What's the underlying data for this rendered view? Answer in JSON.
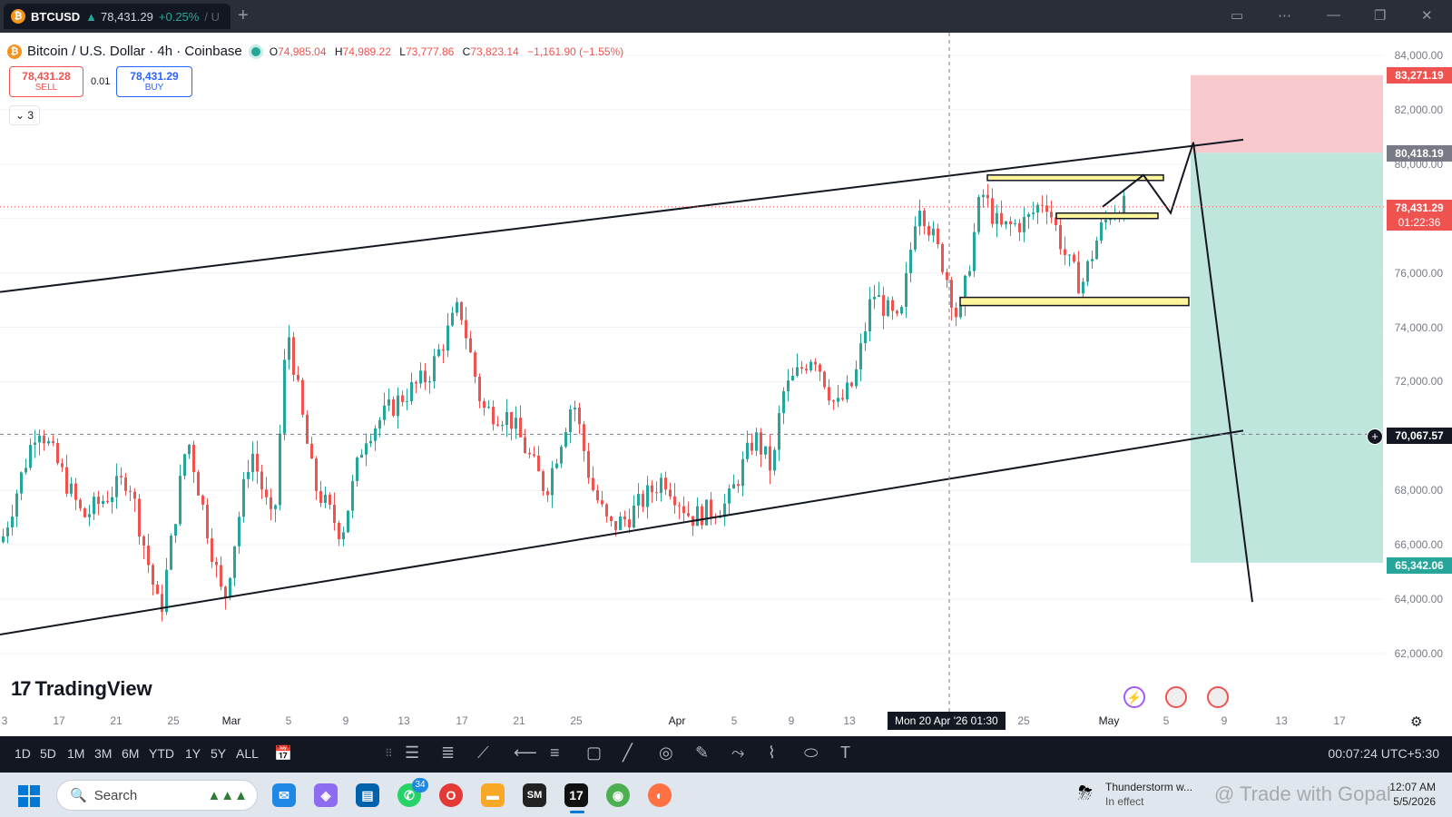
{
  "tab": {
    "symbol": "BTCUSD",
    "direction": "▲",
    "price": "78,431.29",
    "change": "+0.25%",
    "sep": "/ U"
  },
  "legend": {
    "title": "Bitcoin / U.S. Dollar · 4h · Coinbase",
    "o_key": "O",
    "o": "74,985.04",
    "h_key": "H",
    "h": "74,989.22",
    "l_key": "L",
    "l": "73,777.86",
    "c_key": "C",
    "c": "73,823.14",
    "chg": "−1,161.90 (−1.55%)"
  },
  "trade": {
    "sell_price": "78,431.28",
    "sell_label": "SELL",
    "spread": "0.01",
    "buy_price": "78,431.29",
    "buy_label": "BUY",
    "collapse": "3"
  },
  "price_scale": {
    "ticks": [
      "84,000.00",
      "82,000.00",
      "80,000.00",
      "78,000.00",
      "76,000.00",
      "74,000.00",
      "72,000.00",
      "70,000.00",
      "68,000.00",
      "66,000.00",
      "64,000.00",
      "62,000.00"
    ],
    "target_label": "83,271.19",
    "entry_label": "80,418.19",
    "current_price": "78,431.29",
    "countdown": "01:22:36",
    "crosshair_price": "70,067.57",
    "stop_label": "65,342.06"
  },
  "time_axis": {
    "ticks": [
      "3",
      "17",
      "21",
      "25",
      "Mar",
      "5",
      "9",
      "13",
      "17",
      "21",
      "25",
      "Apr",
      "5",
      "9",
      "13",
      "25",
      "May",
      "5",
      "9",
      "13",
      "17"
    ],
    "crosshair_label": "Mon 20 Apr '26   01:30"
  },
  "brand": "TradingView",
  "timeframes": [
    "1D",
    "5D",
    "1M",
    "3M",
    "6M",
    "YTD",
    "1Y",
    "5Y",
    "ALL"
  ],
  "clock": "00:07:24 UTC+5:30",
  "taskbar": {
    "search": "Search",
    "whatsapp_badge": "34",
    "weather_title": "Thunderstorm w...",
    "weather_sub": "In effect",
    "time": "12:07 AM",
    "date": "5/5/2026"
  },
  "watermark": "@ Trade with Gopal",
  "colors": {
    "up": "#26a69a",
    "down": "#ef5350",
    "target_zone": "#f8c9cc",
    "stop_zone": "#bfe6dc",
    "zone_fill": "#fff59d"
  },
  "chart_data": {
    "type": "candlestick",
    "instrument": "BTCUSD",
    "interval": "4h",
    "ylim": [
      61000,
      85500
    ],
    "annotations": {
      "channel_upper": [
        [
          0,
          75300
        ],
        [
          1370,
          80900
        ]
      ],
      "channel_lower": [
        [
          0,
          62700
        ],
        [
          1370,
          70200
        ]
      ],
      "supply_zone_top": [
        79400,
        79600
      ],
      "supply_zone_mid": [
        78000,
        78200
      ],
      "demand_zone": [
        74800,
        75100
      ],
      "short_position": {
        "entry": 80418.19,
        "target": 65342.06,
        "stop": 83271.19
      },
      "projected_path": [
        [
          1215,
          78430
        ],
        [
          1260,
          79600
        ],
        [
          1290,
          78200
        ],
        [
          1315,
          80800
        ],
        [
          1380,
          63900
        ]
      ]
    },
    "price_path": [
      [
        0,
        66100
      ],
      [
        40,
        70500
      ],
      [
        90,
        67000
      ],
      [
        140,
        68500
      ],
      [
        175,
        63400
      ],
      [
        205,
        70000
      ],
      [
        245,
        63800
      ],
      [
        275,
        69600
      ],
      [
        300,
        66500
      ],
      [
        315,
        74100
      ],
      [
        330,
        71000
      ],
      [
        345,
        68200
      ],
      [
        375,
        66400
      ],
      [
        400,
        70000
      ],
      [
        440,
        71400
      ],
      [
        470,
        72200
      ],
      [
        505,
        74800
      ],
      [
        530,
        71000
      ],
      [
        560,
        70700
      ],
      [
        600,
        68000
      ],
      [
        630,
        71400
      ],
      [
        650,
        68200
      ],
      [
        670,
        66600
      ],
      [
        690,
        67000
      ],
      [
        730,
        68500
      ],
      [
        760,
        67000
      ],
      [
        800,
        67500
      ],
      [
        830,
        70000
      ],
      [
        850,
        68700
      ],
      [
        860,
        71500
      ],
      [
        895,
        73100
      ],
      [
        920,
        71000
      ],
      [
        940,
        72000
      ],
      [
        960,
        75300
      ],
      [
        990,
        74000
      ],
      [
        1010,
        78800
      ],
      [
        1040,
        76100
      ],
      [
        1055,
        74100
      ],
      [
        1080,
        79000
      ],
      [
        1100,
        77600
      ],
      [
        1130,
        77900
      ],
      [
        1150,
        78800
      ],
      [
        1175,
        76400
      ],
      [
        1190,
        75500
      ],
      [
        1210,
        77500
      ],
      [
        1225,
        78400
      ],
      [
        1240,
        78430
      ]
    ]
  }
}
